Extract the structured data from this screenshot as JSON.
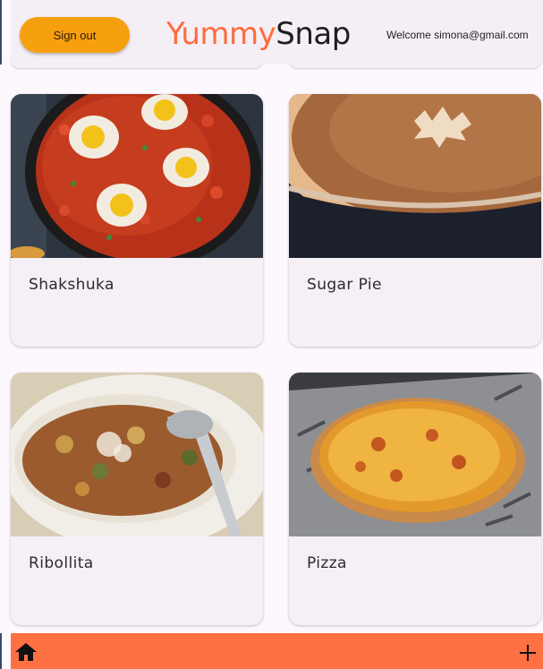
{
  "header": {
    "sign_out_label": "Sign out",
    "brand_part1": "Yummy",
    "brand_part2": "Snap",
    "welcome_text": "Welcome simona@gmail.com"
  },
  "recipes": [
    {
      "title": "Shakshuka"
    },
    {
      "title": "Sugar Pie"
    },
    {
      "title": "Ribollita"
    },
    {
      "title": "Pizza"
    }
  ],
  "bottom_bar": {
    "home_icon": "home-icon",
    "add_icon": "plus-icon"
  },
  "colors": {
    "accent_orange": "#f7a00f",
    "brand_orange": "#ff6b3d",
    "bottom_bar": "#ff7043",
    "surface": "#f4eff5"
  }
}
